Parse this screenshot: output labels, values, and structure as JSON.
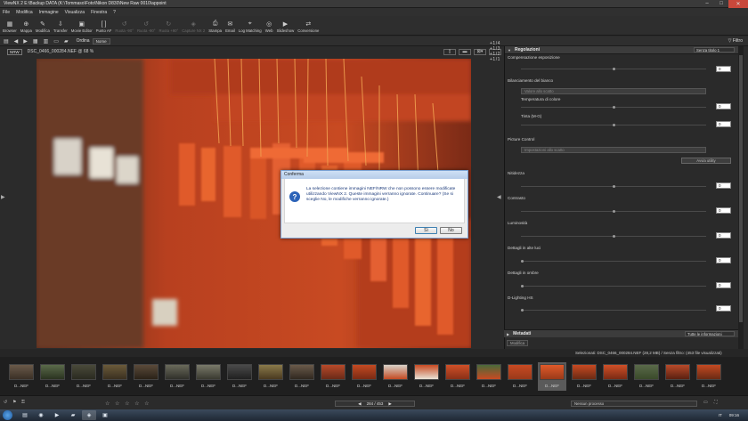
{
  "window": {
    "title": "ViewNX 2   E:\\Backup DATA (K:\\Tommaso\\Foto\\Nikon D830\\New Raw 0010\\appoint",
    "controls": [
      "minimize-icon",
      "maximize-icon",
      "close-icon"
    ]
  },
  "menu": [
    "File",
    "Modifica",
    "Immagine",
    "Visualizza",
    "Finestra",
    "?"
  ],
  "toolbar": {
    "items": [
      {
        "label": "Browser",
        "icon": "browser-icon",
        "enabled": true
      },
      {
        "label": "Mappa",
        "icon": "map-icon",
        "enabled": true
      },
      {
        "label": "Modifica",
        "icon": "edit-icon",
        "enabled": true
      },
      {
        "label": "Transfer",
        "icon": "transfer-icon",
        "enabled": true
      },
      {
        "label": "Movie Editor",
        "icon": "movie-editor-icon",
        "enabled": true
      },
      {
        "label": "Punto AF",
        "icon": "af-point-icon",
        "enabled": true
      },
      {
        "label": "Ruota -90°",
        "icon": "rotate-left-icon",
        "enabled": false
      },
      {
        "label": "Ruota -90°",
        "icon": "rotate-left-icon",
        "enabled": false
      },
      {
        "label": "Ruota +90°",
        "icon": "rotate-right-icon",
        "enabled": false
      },
      {
        "label": "Capture NX 2",
        "icon": "capture-nx-icon",
        "enabled": false
      },
      {
        "label": "Stampa",
        "icon": "print-icon",
        "enabled": true
      },
      {
        "label": "Email",
        "icon": "email-icon",
        "enabled": true
      },
      {
        "label": "Log Matching",
        "icon": "log-matching-icon",
        "enabled": true
      },
      {
        "label": "Web",
        "icon": "web-icon",
        "enabled": true
      },
      {
        "label": "Slideshow",
        "icon": "slideshow-icon",
        "enabled": true
      },
      {
        "label": "Conversione",
        "icon": "conversion-icon",
        "enabled": true
      }
    ]
  },
  "subbar": {
    "order_label": "Ordina",
    "order_value": "Nome",
    "filter_label": "Filtro"
  },
  "viewer": {
    "badge": "NRW",
    "filename": "DSC_0466_000284.NEF @ 68 %",
    "zoom_marks": "+1/4  +1/3  +1/2  +1/1"
  },
  "dialog": {
    "title": "Conferma",
    "message": "La selezione contiene immagini NEF/NRW che non possono essere modificate utilizzando ViewNX 2. Queste immagini verranno ignorate. Continuare? (Se si sceglie No, le modifiche verranno ignorate.)",
    "yes": "Sì",
    "no": "No"
  },
  "adjust_panel": {
    "title": "Regolazioni",
    "preset": "Senza titolo 1",
    "exposure": "Compensazione esposizione",
    "white_balance": "Bilanciamento del bianco",
    "wb_select": "Valore allo scatto",
    "temp": "Temperatura di colore",
    "tint": "Tinta (M-G)",
    "temp_value": "0",
    "tint_value": "0",
    "exposure_value": "0",
    "picture_control": "Picture Control",
    "pc_select": "Impostazioni allo scatto",
    "pc_button": "Avvia utility",
    "sharpness": "Nitidezza",
    "sharpness_value": "0",
    "contrast": "Contrasto",
    "contrast_value": "0",
    "brightness": "Luminosità",
    "brightness_value": "0",
    "highlights": "Dettagli in alte luci",
    "highlights_value": "0",
    "shadows": "Dettagli in ombre",
    "shadows_value": "0",
    "dlighting": "D-Lighting HS",
    "dlighting_value": "0"
  },
  "metadata_panel": {
    "title": "Metadati",
    "select": "Tutte le informazioni",
    "button": "Modifica"
  },
  "status_text": "Selezionati: DSC_0466_000284.NEF (28,2 MB) / Senza filtro: (453 file visualizzati)",
  "filmstrip": {
    "labels": [
      "D...NEF",
      "D...NEF",
      "D...NEF",
      "D...NEF",
      "D...NEF",
      "D...NEF",
      "D...NEF",
      "D...NEF",
      "D...NEF",
      "D...NEF",
      "D...NEF",
      "D...NEF",
      "D...NEF",
      "D...NEF",
      "D...NEF",
      "D...NEF",
      "D...NEF",
      "D...NEF",
      "D...NEF",
      "D...NEF",
      "D...NEF",
      "D...NEF",
      "D...NEF"
    ],
    "selected_index": 17
  },
  "bottom": {
    "pager": "284 / 453",
    "right_select": "Nessun processo",
    "rating": "☆ ☆ ☆ ☆ ☆"
  },
  "taskbar": {
    "lang": "IT",
    "clock": "09:16"
  },
  "colors": {
    "accent": "#e05a2a",
    "dialog_blue": "#2c63b8"
  }
}
